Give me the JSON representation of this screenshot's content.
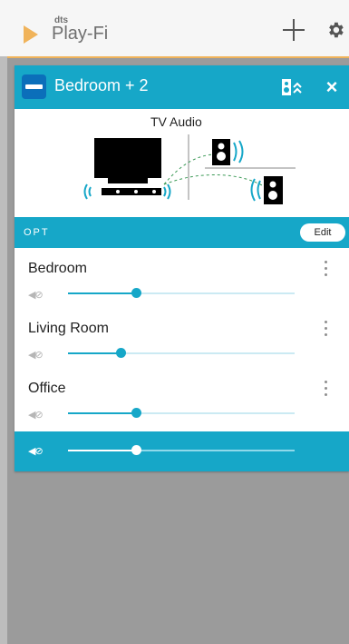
{
  "app": {
    "brand_small": "dts",
    "brand_name": "Play-Fi"
  },
  "topbar": {
    "add_icon": "plus-icon",
    "settings_icon": "gear-icon"
  },
  "zone": {
    "title": "Bedroom + 2",
    "icon": "zone-icon",
    "header_icon": "speaker-collapse-icon",
    "close_icon": "close-icon",
    "diagram_label": "TV Audio",
    "input_label": "OPT",
    "edit_label": "Edit"
  },
  "rooms": [
    {
      "name": "Bedroom",
      "volume": 0.3
    },
    {
      "name": "Living Room",
      "volume": 0.23
    },
    {
      "name": "Office",
      "volume": 0.3
    }
  ],
  "master": {
    "volume": 0.3
  },
  "colors": {
    "accent": "#16a7c8",
    "brand": "#f0b35a",
    "background": "#9b9b9b"
  }
}
